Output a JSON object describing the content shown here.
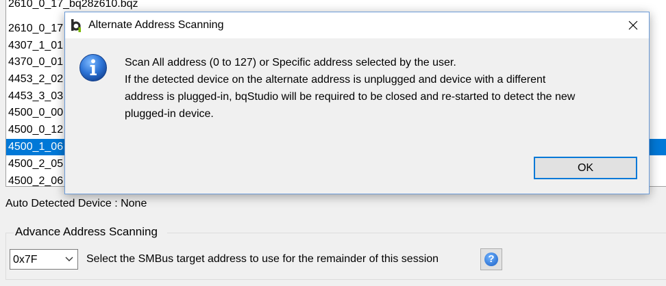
{
  "list": {
    "items": [
      {
        "label": "2610_0_17_bq28z610.bqz"
      },
      {
        "label": "2610_0_17"
      },
      {
        "label": "4307_1_01"
      },
      {
        "label": "4370_0_01"
      },
      {
        "label": "4453_2_02"
      },
      {
        "label": "4453_3_03"
      },
      {
        "label": "4500_0_00"
      },
      {
        "label": "4500_0_12"
      },
      {
        "label": "4500_1_06"
      },
      {
        "label": "4500_2_05"
      },
      {
        "label": "4500_2_06"
      }
    ],
    "selected_index": 8
  },
  "auto_detected": "Auto Detected Device : None",
  "advance": {
    "group_title": "Advance Address Scanning",
    "selected_address": "0x7F",
    "description": "Select the SMBus target address to use for the remainder of this session",
    "help_icon": "question-icon"
  },
  "dialog": {
    "title": "Alternate Address Scanning",
    "app_icon": "bq-app-icon",
    "message_icon": "info-icon",
    "message_lines": [
      "Scan All address (0 to 127) or Specific address selected by the user.",
      "If the detected device on the alternate address is unplugged and device with a different",
      "address is plugged-in, bqStudio will be required to be closed and re-started to detect the new",
      "plugged-in device."
    ],
    "ok_label": "OK"
  },
  "colors": {
    "selection": "#0078d7",
    "dialog_border": "#6b9bd8",
    "window_bg": "#f0f0f0"
  }
}
